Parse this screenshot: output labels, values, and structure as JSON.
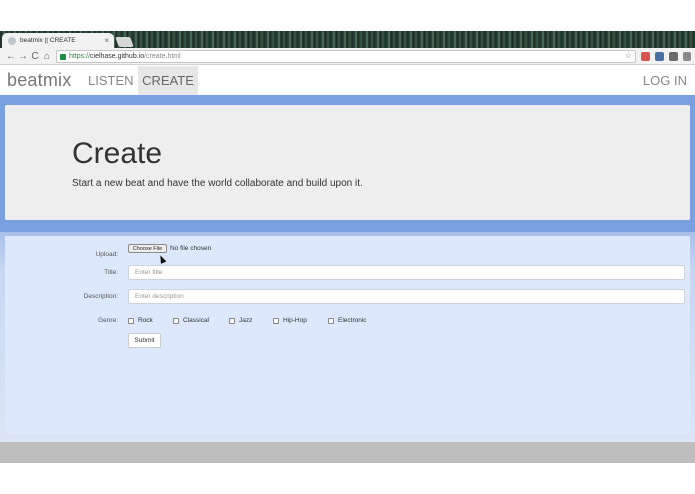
{
  "browser": {
    "tab_title": "beatmix || CREATE",
    "tab_close": "×",
    "url_secure": "https://",
    "url_host": "cielhase.github.io",
    "url_path": "/create.html",
    "nav_back": "←",
    "nav_forward": "→",
    "nav_reload": "C",
    "nav_home": "⌂",
    "star": "☆"
  },
  "navbar": {
    "brand": "beatmix",
    "items": [
      {
        "label": "LISTEN",
        "active": false
      },
      {
        "label": "CREATE",
        "active": true
      }
    ],
    "login": "LOG IN"
  },
  "hero": {
    "title": "Create",
    "lead": "Start a new beat and have the world collaborate and build upon it."
  },
  "form": {
    "upload_label": "Upload:",
    "file_button": "Choose File",
    "file_status": "No file chosen",
    "title_label": "Title:",
    "title_placeholder": "Enter title",
    "description_label": "Description:",
    "description_placeholder": "Enter description",
    "genre_label": "Genre:",
    "genres": [
      "Rock",
      "Classical",
      "Jazz",
      "Hip-Hop",
      "Electronic"
    ],
    "submit": "Submit"
  },
  "colors": {
    "band_blue": "#7ba0e0",
    "panel_blue": "#dde8fc",
    "hero_gray": "#eeeeee"
  }
}
